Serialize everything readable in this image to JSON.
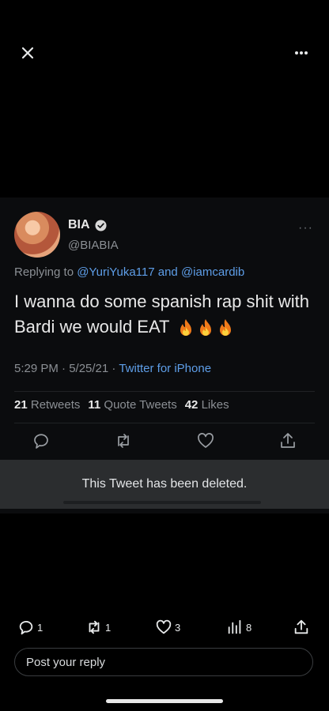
{
  "icons": {
    "close": "close-icon",
    "more": "more-horizontal-icon"
  },
  "tweet": {
    "name": "BIA",
    "handle": "@BIABIA",
    "reply_prefix": "Replying to",
    "mention_1": "@YuriYuka117",
    "reply_and": "and",
    "mention_2": "@iamcardib",
    "text": "I wanna do some spanish rap shit with Bardi we would EAT",
    "time_date": "5:29 PM · 5/25/21 ·",
    "source": "Twitter for iPhone",
    "retweets_count": "21",
    "retweets_label": "Retweets",
    "quotes_count": "11",
    "quotes_label": "Quote Tweets",
    "likes_count": "42",
    "likes_label": "Likes",
    "deleted_notice": "This Tweet has been deleted."
  },
  "engagement": {
    "replies": "1",
    "retweets": "1",
    "likes": "3",
    "views": "8"
  },
  "reply_input": {
    "placeholder": "Post your reply"
  },
  "colors": {
    "background": "#000000",
    "link": "#5e9ee8",
    "muted": "#8b8f94"
  }
}
